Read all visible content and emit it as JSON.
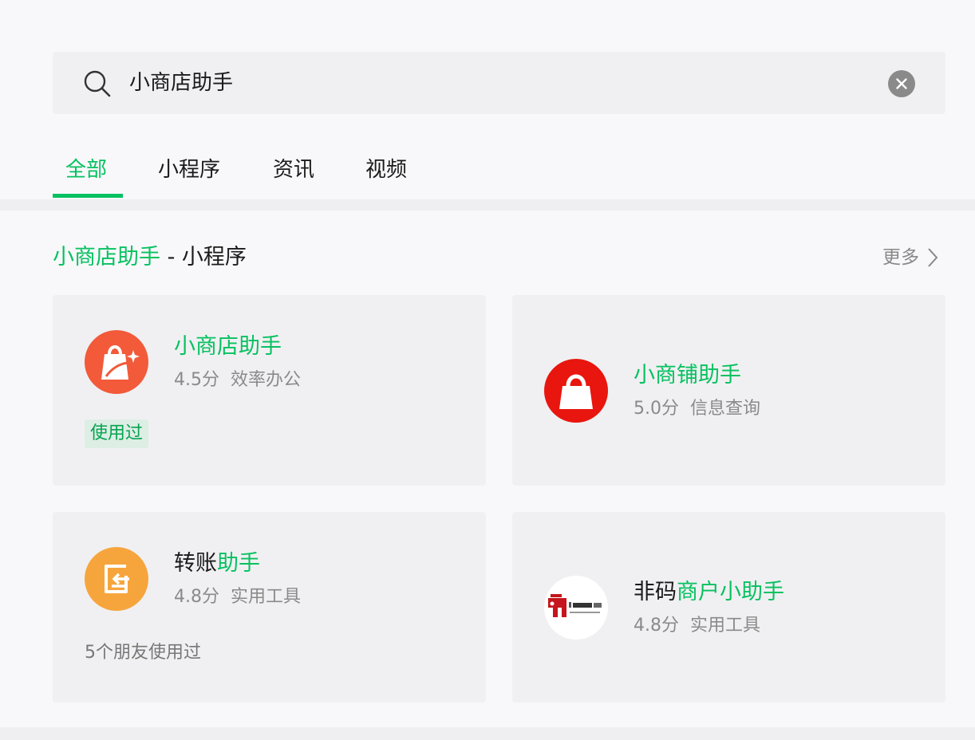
{
  "search": {
    "query": "小商店助手"
  },
  "tabs": [
    {
      "label": "全部"
    },
    {
      "label": "小程序"
    },
    {
      "label": "资讯"
    },
    {
      "label": "视频"
    }
  ],
  "section": {
    "title_keyword": "小商店助手",
    "title_suffix": " - 小程序",
    "more_label": "更多"
  },
  "cards": [
    {
      "name_parts": [
        "小商店助手"
      ],
      "rating": "4.5分",
      "category": "效率办公",
      "tag": "使用过",
      "logo": "shopping-bag-icon",
      "logo_color": "#f25a3a"
    },
    {
      "name_parts": [
        "小商铺助手"
      ],
      "rating": "5.0分",
      "category": "信息查询",
      "logo": "bag-icon",
      "logo_color": "#e8160e"
    },
    {
      "name_parts": [
        "转账",
        "助手"
      ],
      "rating": "4.8分",
      "category": "实用工具",
      "friends": "5个朋友使用过",
      "logo": "transfer-icon",
      "logo_color": "#f6a53d"
    },
    {
      "name_parts": [
        "非码",
        "商户",
        "小助手"
      ],
      "rating": "4.8分",
      "category": "实用工具",
      "logo": "feima-logo",
      "logo_color": "#c4161c"
    }
  ],
  "colors": {
    "accent": "#07c160"
  }
}
